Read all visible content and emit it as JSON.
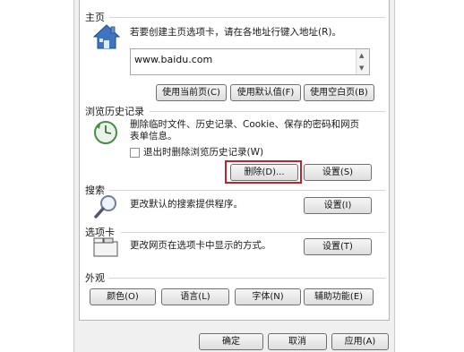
{
  "home": {
    "title": "主页",
    "description": "若要创建主页选项卡，请在各地址行键入地址(R)。",
    "url": "www.baidu.com",
    "buttons": [
      "使用当前页(C)",
      "使用默认值(F)",
      "使用空白页(B)"
    ]
  },
  "history": {
    "title": "浏览历史记录",
    "description_line1": "删除临时文件、历史记录、Cookie、保存的密码和网页",
    "description_line2": "表单信息。",
    "checkbox_label": "退出时删除浏览历史记录(W)",
    "checkbox_checked": false,
    "delete_button": "删除(D)...",
    "settings_button": "设置(S)"
  },
  "search": {
    "title": "搜索",
    "description": "更改默认的搜索提供程序。",
    "settings_button": "设置(I)"
  },
  "tabs": {
    "title": "选项卡",
    "description": "更改网页在选项卡中显示的方式。",
    "settings_button": "设置(T)"
  },
  "appearance": {
    "title": "外观",
    "buttons": [
      "颜色(O)",
      "语言(L)",
      "字体(N)",
      "辅助功能(E)"
    ]
  },
  "footer": {
    "ok": "确定",
    "cancel": "取消",
    "apply": "应用(A)"
  },
  "colors": {
    "highlight": "#c0232c"
  }
}
